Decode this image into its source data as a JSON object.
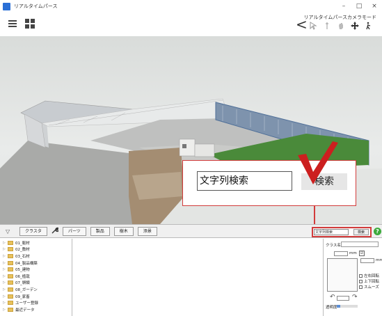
{
  "window": {
    "title": "リアルタイムパース",
    "minimize": "–",
    "maximize": "□",
    "close": "×"
  },
  "toolbar": {
    "mode_label": "リアルタイムパースカメラモード",
    "back": "<",
    "icons": [
      "cursor-icon",
      "wand-icon",
      "hand-icon",
      "move-icon",
      "walk-icon"
    ]
  },
  "callout": {
    "input_text": "文字列検索",
    "button_label": "検索"
  },
  "tabs": {
    "filter": "▽",
    "items": [
      "クラスタ",
      "パーツ",
      "製品",
      "樹木",
      "添景"
    ]
  },
  "search": {
    "input_text": "文字列検索",
    "button_label": "検索",
    "help": "?"
  },
  "tree": {
    "items": [
      "01_躯材",
      "02_敷材",
      "03_石材",
      "04_製品構築",
      "05_建物",
      "06_植栽",
      "07_塀類",
      "08_ガーデン",
      "09_家畜",
      "ユーザー登録",
      "最近データ"
    ]
  },
  "props": {
    "class_label": "クラス名",
    "width_unit": "mm",
    "height_unit": "mm",
    "lock": "☑",
    "options": [
      "左右回転",
      "上下回転",
      "スムーズ"
    ],
    "rot_left": "↶",
    "rot_right": "↷",
    "transparency_label": "透明度",
    "transparency_level": 0.15
  },
  "colors": {
    "accent": "#d23b3b",
    "check": "#cc1f1f",
    "grass": "#4a8a3a"
  }
}
